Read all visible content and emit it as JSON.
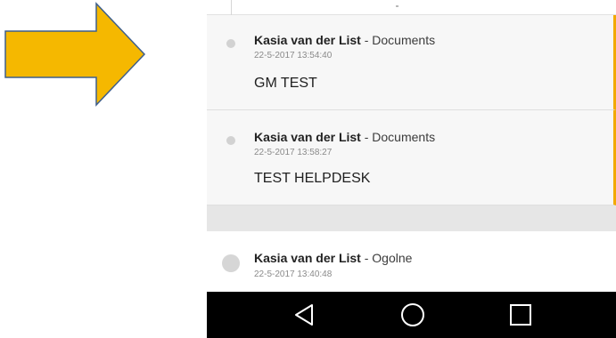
{
  "annotation": {
    "arrow_color": "#f5b800",
    "arrow_outline_color": "#3e5f8c",
    "icon": "arrow-right-icon"
  },
  "app": {
    "accent_color": "#f2a900"
  },
  "feed": {
    "items": [
      {
        "author": "Kasia van der List",
        "separator": "- ",
        "category": "Documents",
        "timestamp": "22-5-2017 13:54:40",
        "message": "GM TEST"
      },
      {
        "author": "Kasia van der List",
        "separator": "- ",
        "category": "Documents",
        "timestamp": "22-5-2017 13:58:27",
        "message": "TEST HELPDESK"
      },
      {
        "author": "Kasia van der List",
        "separator": "- ",
        "category": "Ogolne",
        "timestamp": "22-5-2017 13:40:48"
      }
    ]
  },
  "navbar": {
    "buttons": [
      "back-triangle-icon",
      "home-circle-icon",
      "recents-square-icon"
    ]
  }
}
